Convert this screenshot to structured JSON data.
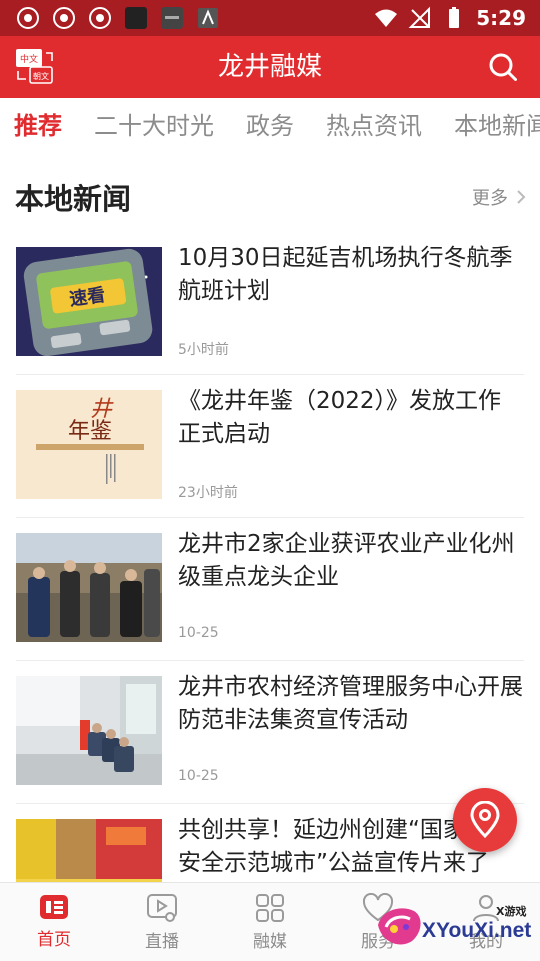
{
  "status_bar": {
    "time": "5:29",
    "icons": [
      "chrome-icon",
      "chrome-icon",
      "chrome-icon",
      "app-icon",
      "app-icon",
      "app-icon",
      "wifi-icon",
      "no-signal-icon",
      "battery-icon"
    ]
  },
  "app_bar": {
    "title": "龙井融媒",
    "translate_icon_text_top": "中文",
    "translate_icon_text_bottom": "朝文"
  },
  "tabs": [
    {
      "label": "推荐",
      "active": true
    },
    {
      "label": "二十大时光",
      "active": false
    },
    {
      "label": "政务",
      "active": false
    },
    {
      "label": "热点资讯",
      "active": false
    },
    {
      "label": "本地新闻",
      "active": false
    }
  ],
  "section": {
    "title": "本地新闻",
    "more_label": "更多"
  },
  "news": [
    {
      "title": "10月30日起延吉机场执行冬航季航班计划",
      "time": "5小时前",
      "thumb_text": "速看"
    },
    {
      "title": "《龙井年鉴（2022）》发放工作正式启动",
      "time": "23小时前",
      "thumb_text": "年鉴"
    },
    {
      "title": "龙井市2家企业获评农业产业化州级重点龙头企业",
      "time": "10-25"
    },
    {
      "title": "龙井市农村经济管理服务中心开展防范非法集资宣传活动",
      "time": "10-25"
    },
    {
      "title": "共创共享！延边州创建“国家食品安全示范城市”公益宣传片来了",
      "time": ""
    }
  ],
  "bottom_nav": [
    {
      "label": "首页",
      "icon": "home-icon",
      "active": true
    },
    {
      "label": "直播",
      "icon": "live-icon",
      "active": false
    },
    {
      "label": "融媒",
      "icon": "grid-icon",
      "active": false
    },
    {
      "label": "服务",
      "icon": "service-icon",
      "active": false
    },
    {
      "label": "我的",
      "icon": "user-icon",
      "active": false
    }
  ],
  "watermark": {
    "text": "XYouXi.net",
    "small": "X游戏"
  },
  "colors": {
    "brand_red": "#e12c2f",
    "status_bar": "#a81d22"
  }
}
